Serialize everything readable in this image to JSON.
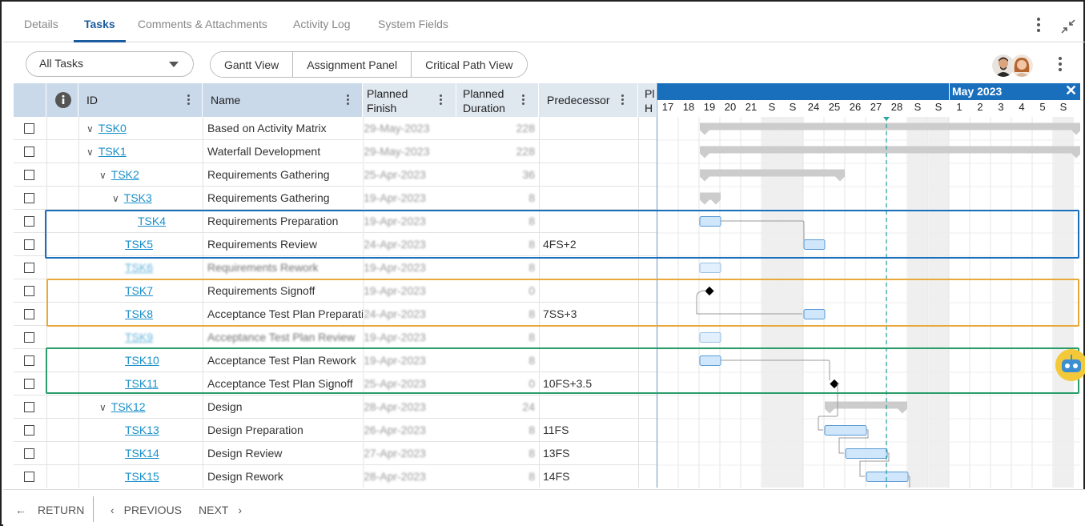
{
  "tabs": [
    "Details",
    "Tasks",
    "Comments & Attachments",
    "Activity Log",
    "System Fields"
  ],
  "active_tab": "Tasks",
  "filter": {
    "selected": "All Tasks"
  },
  "views": [
    "Gantt View",
    "Assignment Panel",
    "Critical Path View"
  ],
  "columns": {
    "id": "ID",
    "name": "Name",
    "planned_finish": "Planned Finish",
    "planned_finish_l1": "Planned",
    "planned_finish_l2": "Finish",
    "planned_duration_l1": "Planned",
    "planned_duration_l2": "Duration",
    "predecessor": "Predecessor",
    "planned_hours_l1": "Pl",
    "planned_hours_l2": "H"
  },
  "rows": [
    {
      "id": "TSK0",
      "name": "Based on Activity Matrix",
      "finish": "29-May-2023",
      "duration": "228",
      "pred": ""
    },
    {
      "id": "TSK1",
      "name": "Waterfall Development",
      "finish": "29-May-2023",
      "duration": "228",
      "pred": ""
    },
    {
      "id": "TSK2",
      "name": "Requirements Gathering",
      "finish": "25-Apr-2023",
      "duration": "36",
      "pred": ""
    },
    {
      "id": "TSK3",
      "name": "Requirements Gathering",
      "finish": "19-Apr-2023",
      "duration": "8",
      "pred": ""
    },
    {
      "id": "TSK4",
      "name": "Requirements Preparation",
      "finish": "19-Apr-2023",
      "duration": "8",
      "pred": ""
    },
    {
      "id": "TSK5",
      "name": "Requirements Review",
      "finish": "24-Apr-2023",
      "duration": "8",
      "pred": "4FS+2"
    },
    {
      "id": "TSK6",
      "name": "Requirements Rework",
      "finish": "19-Apr-2023",
      "duration": "8",
      "pred": ""
    },
    {
      "id": "TSK7",
      "name": "Requirements Signoff",
      "finish": "19-Apr-2023",
      "duration": "0",
      "pred": ""
    },
    {
      "id": "TSK8",
      "name": "Acceptance Test Plan Preparatic",
      "finish": "24-Apr-2023",
      "duration": "8",
      "pred": "7SS+3"
    },
    {
      "id": "TSK9",
      "name": "Acceptance Test Plan Review",
      "finish": "19-Apr-2023",
      "duration": "8",
      "pred": ""
    },
    {
      "id": "TSK10",
      "name": "Acceptance Test Plan Rework",
      "finish": "19-Apr-2023",
      "duration": "8",
      "pred": ""
    },
    {
      "id": "TSK11",
      "name": "Acceptance Test Plan Signoff",
      "finish": "25-Apr-2023",
      "duration": "0",
      "pred": "10FS+3.5"
    },
    {
      "id": "TSK12",
      "name": "Design",
      "finish": "28-Apr-2023",
      "duration": "24",
      "pred": ""
    },
    {
      "id": "TSK13",
      "name": "Design Preparation",
      "finish": "26-Apr-2023",
      "duration": "8",
      "pred": "11FS"
    },
    {
      "id": "TSK14",
      "name": "Design Review",
      "finish": "27-Apr-2023",
      "duration": "8",
      "pred": "13FS"
    },
    {
      "id": "TSK15",
      "name": "Design Rework",
      "finish": "28-Apr-2023",
      "duration": "8",
      "pred": "14FS"
    }
  ],
  "gantt": {
    "month": "May 2023",
    "days": [
      "17",
      "18",
      "19",
      "20",
      "21",
      "S",
      "S",
      "24",
      "25",
      "26",
      "27",
      "28",
      "S",
      "S",
      "1",
      "2",
      "3",
      "4",
      "5",
      "S"
    ]
  },
  "footer": {
    "return": "RETURN",
    "previous": "PREVIOUS",
    "next": "NEXT"
  },
  "colors": {
    "accent": "#1a5c9e",
    "gantt_header": "#1a6fbd",
    "task_bar": "#cfe6fb",
    "summary_bar": "#cccccc",
    "today_line": "#2aa3a3",
    "highlight_blue": "#1a6fbd",
    "highlight_orange": "#e8a93b",
    "highlight_green": "#2a9d6a"
  }
}
